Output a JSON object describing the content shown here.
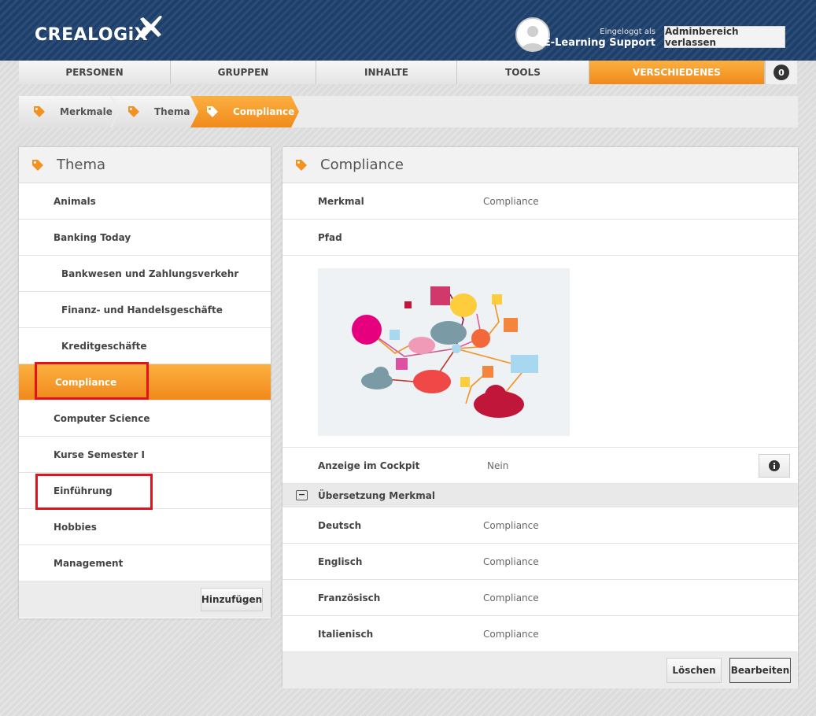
{
  "header": {
    "logo_text": "CREALOGiX",
    "logged_in_label": "Eingeloggt als",
    "user_name": "E-Learning Support",
    "exit_admin_label": "Adminbereich verlassen"
  },
  "nav": {
    "items": [
      {
        "label": "PERSONEN",
        "active": false
      },
      {
        "label": "GRUPPEN",
        "active": false
      },
      {
        "label": "INHALTE",
        "active": false
      },
      {
        "label": "TOOLS",
        "active": false
      },
      {
        "label": "VERSCHIEDENES",
        "active": true
      }
    ],
    "notification_count": "0"
  },
  "breadcrumb": {
    "items": [
      {
        "label": "Merkmale"
      },
      {
        "label": "Thema"
      },
      {
        "label": "Compliance"
      }
    ]
  },
  "left_panel": {
    "title": "Thema",
    "items": [
      {
        "label": "Animals",
        "level": 1
      },
      {
        "label": "Banking Today",
        "level": 1
      },
      {
        "label": "Bankwesen und Zahlungsverkehr",
        "level": 2
      },
      {
        "label": "Finanz- und Handelsgeschäfte",
        "level": 2
      },
      {
        "label": "Kreditgeschäfte",
        "level": 2
      },
      {
        "label": "Compliance",
        "level": 1,
        "selected": true
      },
      {
        "label": "Computer Science",
        "level": 1
      },
      {
        "label": "Kurse Semester I",
        "level": 1
      },
      {
        "label": "Einführung",
        "level": 1
      },
      {
        "label": "Hobbies",
        "level": 1
      },
      {
        "label": "Management",
        "level": 1
      }
    ],
    "add_button": "Hinzufügen"
  },
  "right_panel": {
    "title": "Compliance",
    "merkmal_label": "Merkmal",
    "merkmal_value": "Compliance",
    "pfad_label": "Pfad",
    "cockpit_label": "Anzeige im Cockpit",
    "cockpit_value": "Nein",
    "translation_section": "Übersetzung Merkmal",
    "translations": [
      {
        "lang": "Deutsch",
        "value": "Compliance"
      },
      {
        "lang": "Englisch",
        "value": "Compliance"
      },
      {
        "lang": "Französisch",
        "value": "Compliance"
      },
      {
        "lang": "Italienisch",
        "value": "Compliance"
      }
    ],
    "delete_button": "Löschen",
    "edit_button": "Bearbeiten"
  },
  "colors": {
    "accent_orange": "#f39220",
    "header_blue": "#1d3f6b",
    "highlight_red": "#e0141e"
  }
}
